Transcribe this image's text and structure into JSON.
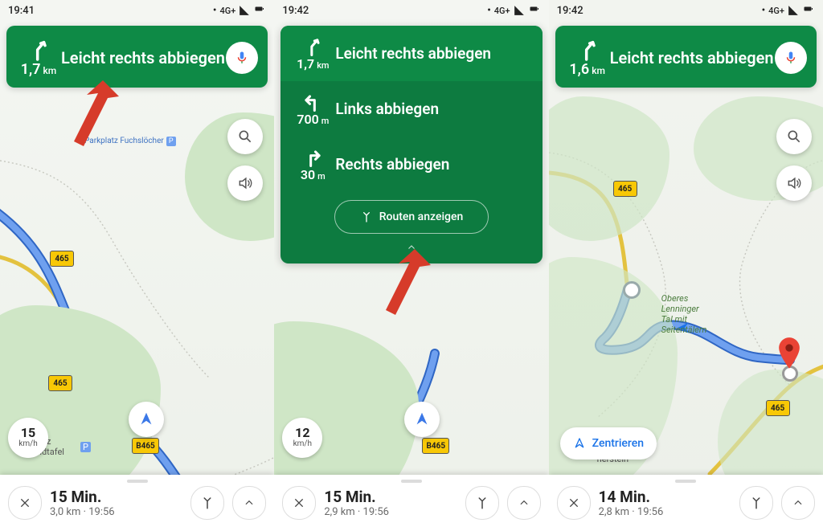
{
  "panels": [
    {
      "statusbar": {
        "time": "19:41",
        "net": "4G+"
      },
      "banner": {
        "distance": "1,7",
        "unit": "km",
        "instruction": "Leicht rechts abbiegen"
      },
      "speed": {
        "value": "15",
        "unit": "km/h"
      },
      "shields": {
        "a": "465",
        "b": "465",
        "c": "B465"
      },
      "poi": {
        "parkplatz": "Parkplatz Fuchslöcher",
        "landtafel": "kplatz\nLandtafel"
      },
      "bottom": {
        "eta": "15 Min.",
        "detail": "3,0 km · 19:56"
      }
    },
    {
      "statusbar": {
        "time": "19:42",
        "net": "4G+"
      },
      "steps": [
        {
          "distance": "1,7",
          "unit": "km",
          "instruction": "Leicht rechts abbiegen"
        },
        {
          "distance": "700",
          "unit": "m",
          "instruction": "Links abbiegen"
        },
        {
          "distance": "30",
          "unit": "m",
          "instruction": "Rechts abbiegen"
        }
      ],
      "show_routes_label": "Routen anzeigen",
      "speed": {
        "value": "12",
        "unit": "km/h"
      },
      "shields": {
        "c": "B465"
      },
      "bottom": {
        "eta": "15 Min.",
        "detail": "2,9 km · 19:56"
      }
    },
    {
      "statusbar": {
        "time": "19:42",
        "net": "4G+"
      },
      "banner": {
        "distance": "1,6",
        "unit": "km",
        "instruction": "Leicht rechts abbiegen"
      },
      "center_label": "Zentrieren",
      "map_labels": {
        "oberes": "Oberes\nLenninger\nTal mit\nSeitentälern",
        "herstein": "herstein"
      },
      "shields": {
        "a": "465",
        "b": "465"
      },
      "bottom": {
        "eta": "14 Min.",
        "detail": "2,8 km · 19:56"
      }
    }
  ]
}
